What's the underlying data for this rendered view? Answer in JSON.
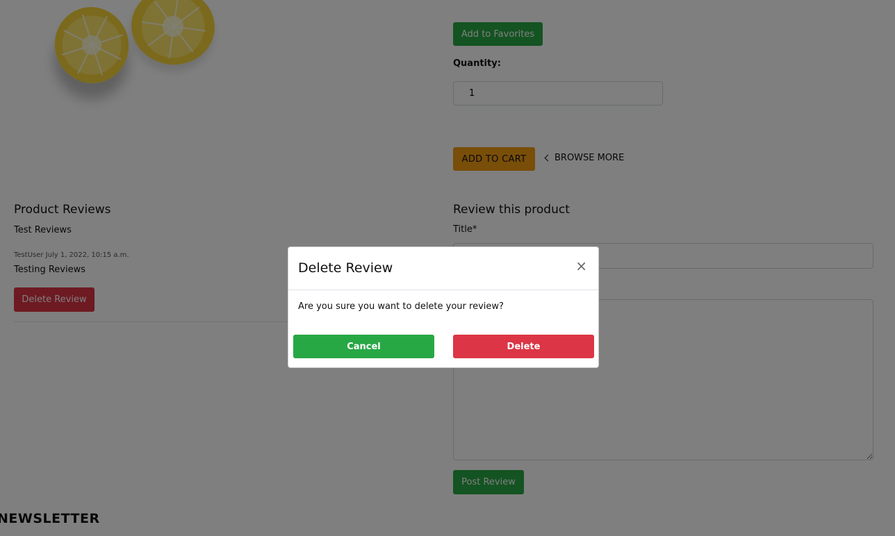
{
  "product": {
    "favorites_label": "Add to Favorites",
    "quantity_label": "Quantity:",
    "quantity_value": "1",
    "add_to_cart_label": "ADD TO CART",
    "browse_more_label": "BROWSE MORE"
  },
  "reviews": {
    "heading": "Product Reviews",
    "items": [
      {
        "title": "Test Reviews"
      },
      {
        "author_date": "TestUser July 1, 2022, 10:15 a.m.",
        "title": "Testing Reviews"
      }
    ],
    "delete_label": "Delete Review"
  },
  "review_form": {
    "heading": "Review this product",
    "title_label": "Title*",
    "post_label": "Post Review"
  },
  "footer": {
    "newsletter_label": "NEWSLETTER"
  },
  "modal": {
    "title": "Delete Review",
    "close_symbol": "×",
    "message": "Are you sure you want to delete your review?",
    "cancel_label": "Cancel",
    "delete_label": "Delete"
  }
}
